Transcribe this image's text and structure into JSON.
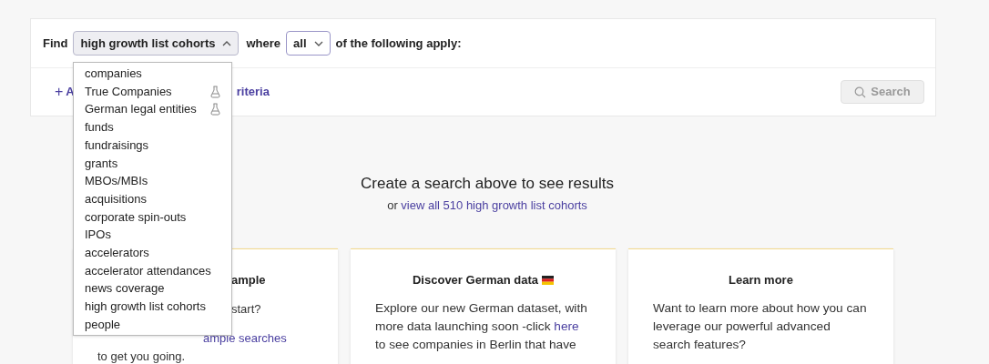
{
  "query": {
    "find_label": "Find",
    "entity_select": {
      "value": "high growth list cohorts",
      "expanded": true
    },
    "where_label": "where",
    "match_select": {
      "value": "all",
      "expanded": false
    },
    "tail": "of the following apply:"
  },
  "add_criteria": {
    "icon": "+",
    "visible_parts": [
      "A",
      "riteria"
    ]
  },
  "search_button": {
    "label": "Search",
    "disabled": true
  },
  "dropdown": [
    {
      "label": "companies",
      "beta": false
    },
    {
      "label": "True Companies",
      "beta": true
    },
    {
      "label": "German legal entities",
      "beta": true
    },
    {
      "label": "funds",
      "beta": false
    },
    {
      "label": "fundraisings",
      "beta": false
    },
    {
      "label": "grants",
      "beta": false
    },
    {
      "label": "MBOs/MBIs",
      "beta": false
    },
    {
      "label": "acquisitions",
      "beta": false
    },
    {
      "label": "corporate spin-outs",
      "beta": false
    },
    {
      "label": "IPOs",
      "beta": false
    },
    {
      "label": "accelerators",
      "beta": false
    },
    {
      "label": "accelerator attendances",
      "beta": false
    },
    {
      "label": "news coverage",
      "beta": false
    },
    {
      "label": "high growth list cohorts",
      "beta": false
    },
    {
      "label": "people",
      "beta": false
    }
  ],
  "empty_state": {
    "heading": "Create a search above to see results",
    "prefix": "or",
    "link": "view all 510 high growth list cohorts"
  },
  "cards": [
    {
      "title": "ample",
      "lines": [
        {
          "text": "start?",
          "link": false
        },
        {
          "text": "ample searches",
          "link": true
        },
        {
          "text": "to get you going.",
          "link": false
        }
      ]
    },
    {
      "title": "Discover German data",
      "flag": true,
      "body": "Explore our new German dataset, with more data launching soon -click ",
      "link": "here",
      "body_after": " to see companies in Berlin that have"
    },
    {
      "title": "Learn more",
      "body": "Want to learn more about how you can leverage our powerful advanced search features?"
    }
  ]
}
